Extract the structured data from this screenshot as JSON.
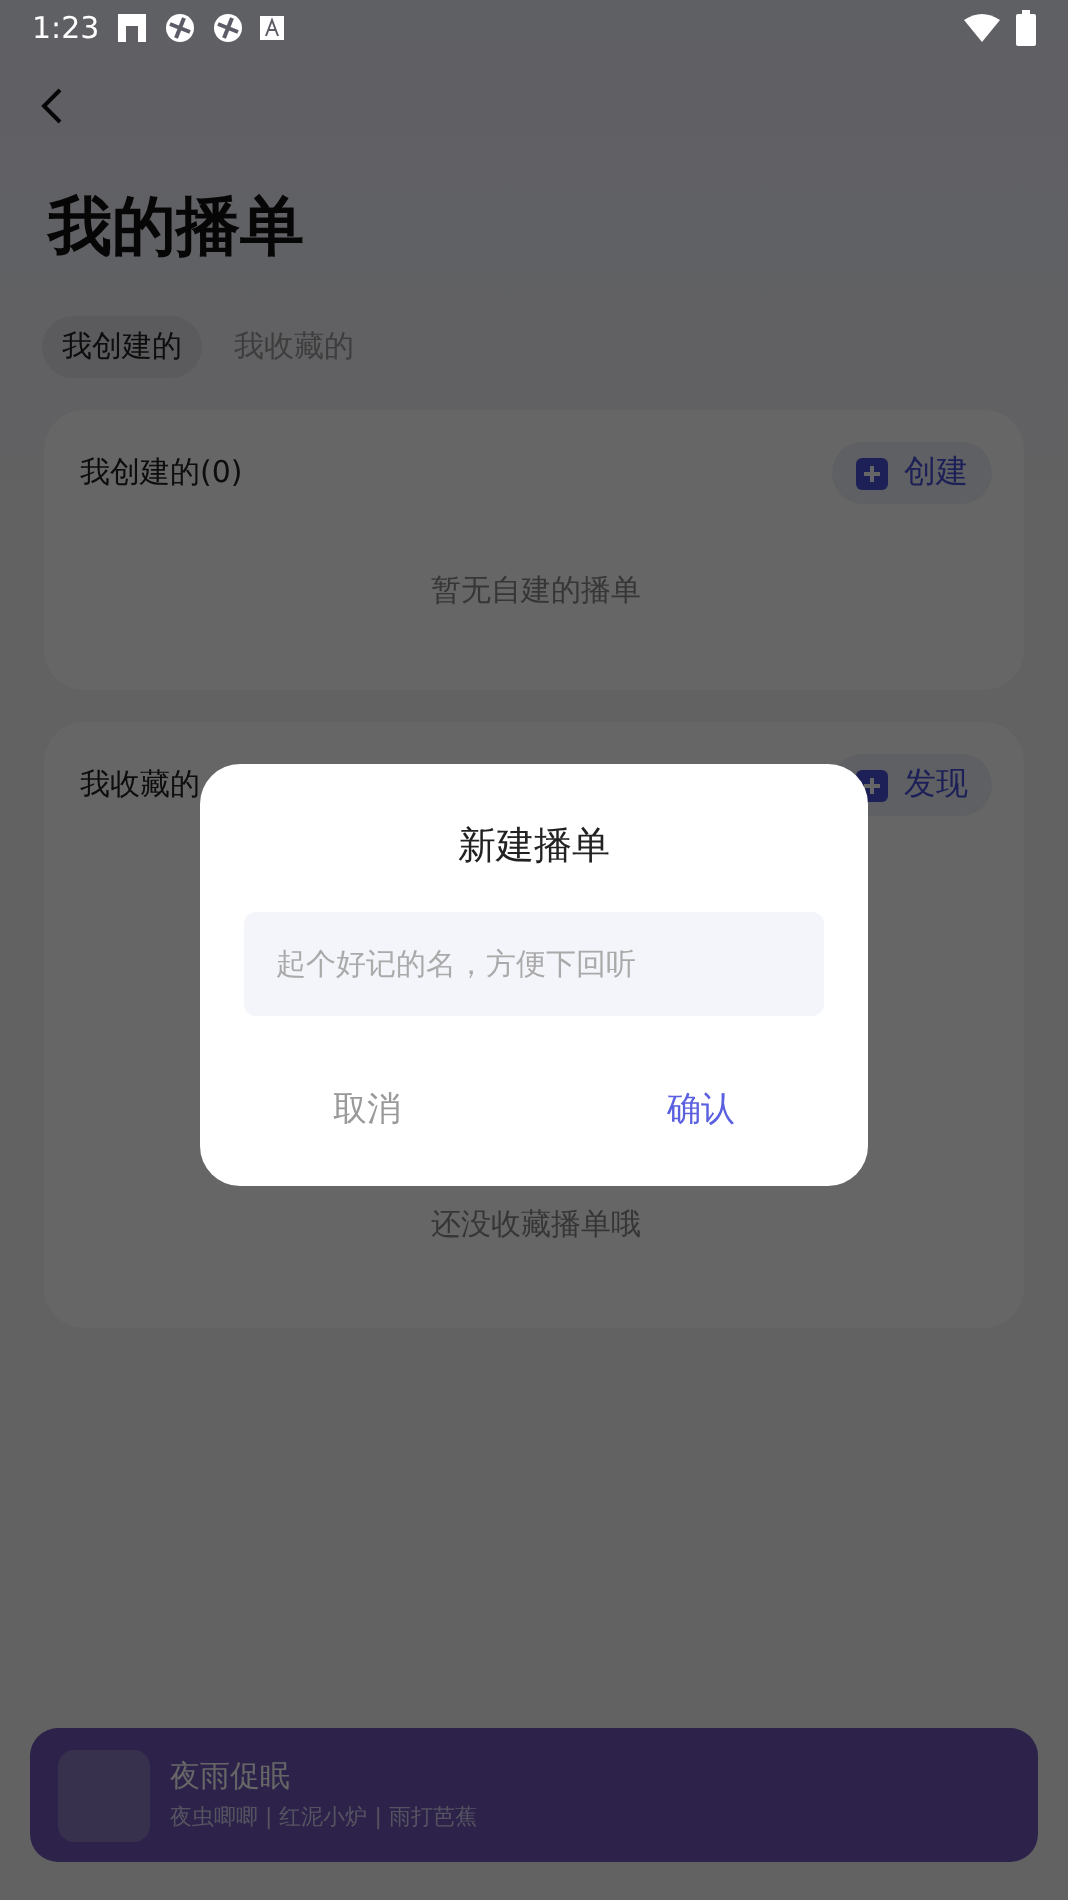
{
  "status_bar": {
    "time": "1:23"
  },
  "title": "我的播单",
  "tabs": [
    {
      "label": "我创建的",
      "selected": true
    },
    {
      "label": "我收藏的",
      "selected": false
    }
  ],
  "sections": [
    {
      "title": "我创建的(0)",
      "action": "创建",
      "empty": "暂无自建的播单"
    },
    {
      "title": "我收藏的",
      "action": "发现",
      "empty": "还没收藏播单哦"
    }
  ],
  "dialog": {
    "title": "新建播单",
    "placeholder": "起个好记的名，方便下回听",
    "cancel": "取消",
    "confirm": "确认"
  },
  "player": {
    "title": "夜雨促眠",
    "subtitle": "夜虫唧唧 | 红泥小炉 | 雨打芭蕉"
  }
}
